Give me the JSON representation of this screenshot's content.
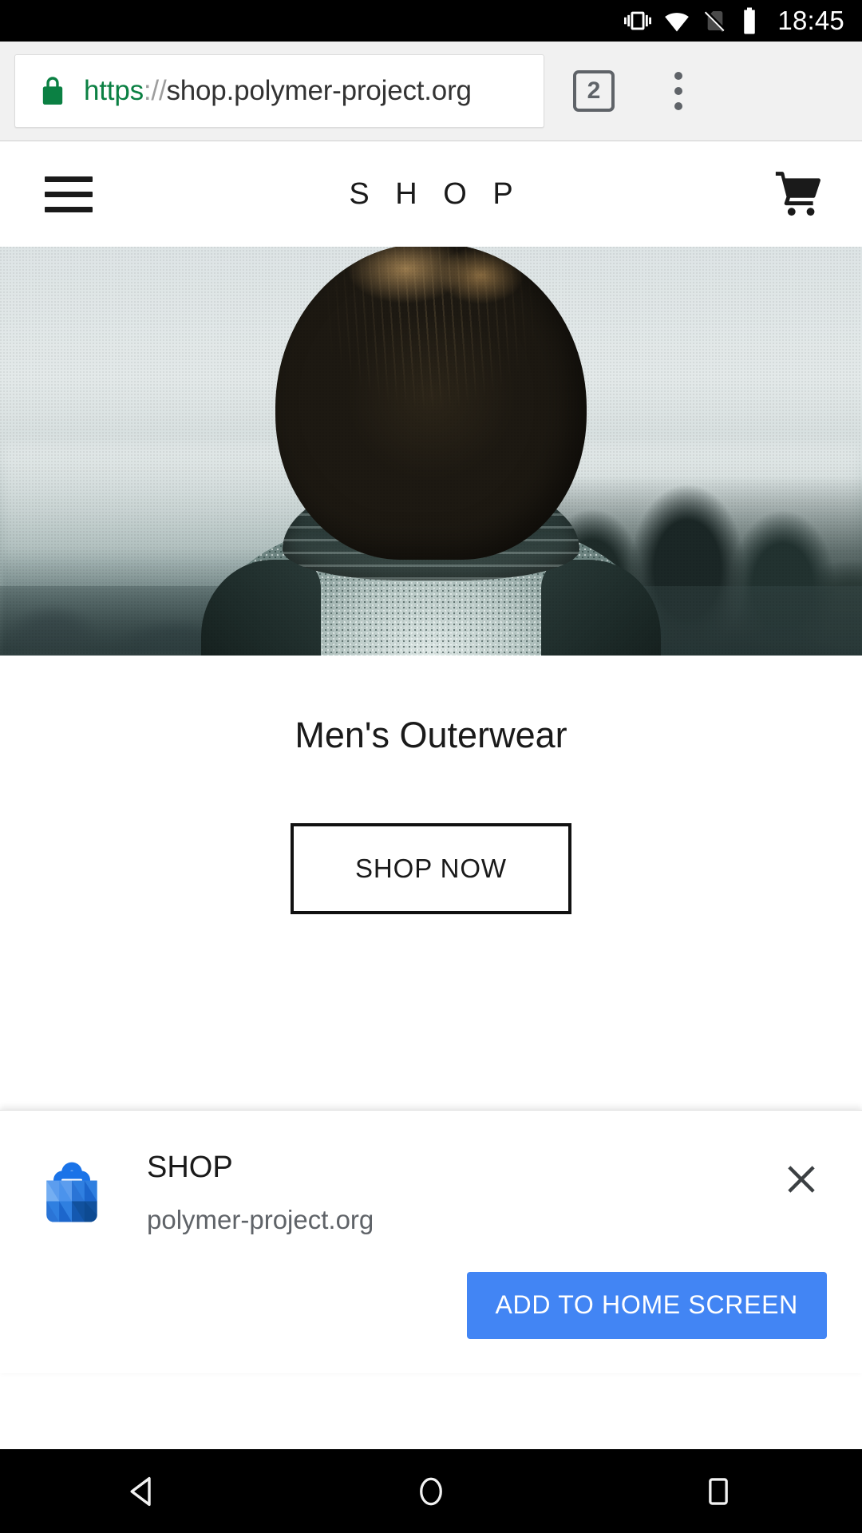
{
  "status_bar": {
    "time": "18:45",
    "icons": [
      "vibrate-icon",
      "wifi-icon",
      "no-sim-icon",
      "battery-icon"
    ]
  },
  "browser": {
    "url_scheme": "https",
    "url_separator": "://",
    "url_host": "shop.polymer-project.org",
    "full_url": "https://shop.polymer-project.org",
    "secure_icon": "lock-icon",
    "tab_count": "2",
    "menu_icon": "overflow-menu-icon",
    "secure_color": "#0b8043"
  },
  "app_header": {
    "menu_icon": "hamburger-menu-icon",
    "title": "S H O P",
    "cart_icon": "shopping-cart-icon"
  },
  "hero": {
    "alt": "man-from-behind-in-knit-sweater-looking-at-misty-landscape"
  },
  "promo": {
    "title": "Men's Outerwear",
    "cta_label": "SHOP NOW"
  },
  "a2hs_banner": {
    "app_icon": "shop-bag-app-icon",
    "app_name": "SHOP",
    "app_origin": "polymer-project.org",
    "close_icon": "close-icon",
    "add_button_label": "ADD TO HOME SCREEN",
    "accent_color": "#4285f4"
  },
  "nav_bar": {
    "back_icon": "back-triangle-icon",
    "home_icon": "home-circle-icon",
    "recents_icon": "recents-square-icon"
  }
}
